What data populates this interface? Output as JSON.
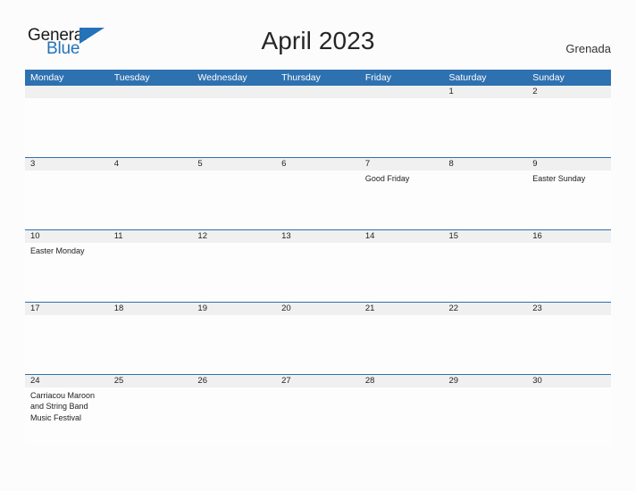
{
  "brand": {
    "name_part1": "General",
    "name_part2": "Blue",
    "triangle_icon": "triangle-icon",
    "accent_color": "#2472b8"
  },
  "header": {
    "title": "April 2023",
    "country": "Grenada"
  },
  "colors": {
    "header_blue": "#2e71b0",
    "date_band_gray": "#f0f0f0",
    "page_background": "#fcfcfc",
    "text": "#222222"
  },
  "calendar": {
    "month": "April",
    "year": "2023",
    "weekday_headers": [
      "Monday",
      "Tuesday",
      "Wednesday",
      "Thursday",
      "Friday",
      "Saturday",
      "Sunday"
    ],
    "weeks": [
      {
        "days": [
          {
            "date": "",
            "events": []
          },
          {
            "date": "",
            "events": []
          },
          {
            "date": "",
            "events": []
          },
          {
            "date": "",
            "events": []
          },
          {
            "date": "",
            "events": []
          },
          {
            "date": "1",
            "events": []
          },
          {
            "date": "2",
            "events": []
          }
        ]
      },
      {
        "days": [
          {
            "date": "3",
            "events": []
          },
          {
            "date": "4",
            "events": []
          },
          {
            "date": "5",
            "events": []
          },
          {
            "date": "6",
            "events": []
          },
          {
            "date": "7",
            "events": [
              "Good Friday"
            ]
          },
          {
            "date": "8",
            "events": []
          },
          {
            "date": "9",
            "events": [
              "Easter Sunday"
            ]
          }
        ]
      },
      {
        "days": [
          {
            "date": "10",
            "events": [
              "Easter Monday"
            ]
          },
          {
            "date": "11",
            "events": []
          },
          {
            "date": "12",
            "events": []
          },
          {
            "date": "13",
            "events": []
          },
          {
            "date": "14",
            "events": []
          },
          {
            "date": "15",
            "events": []
          },
          {
            "date": "16",
            "events": []
          }
        ]
      },
      {
        "days": [
          {
            "date": "17",
            "events": []
          },
          {
            "date": "18",
            "events": []
          },
          {
            "date": "19",
            "events": []
          },
          {
            "date": "20",
            "events": []
          },
          {
            "date": "21",
            "events": []
          },
          {
            "date": "22",
            "events": []
          },
          {
            "date": "23",
            "events": []
          }
        ]
      },
      {
        "days": [
          {
            "date": "24",
            "events": [
              "Carriacou Maroon and String Band Music Festival"
            ]
          },
          {
            "date": "25",
            "events": []
          },
          {
            "date": "26",
            "events": []
          },
          {
            "date": "27",
            "events": []
          },
          {
            "date": "28",
            "events": []
          },
          {
            "date": "29",
            "events": []
          },
          {
            "date": "30",
            "events": []
          }
        ]
      }
    ]
  }
}
